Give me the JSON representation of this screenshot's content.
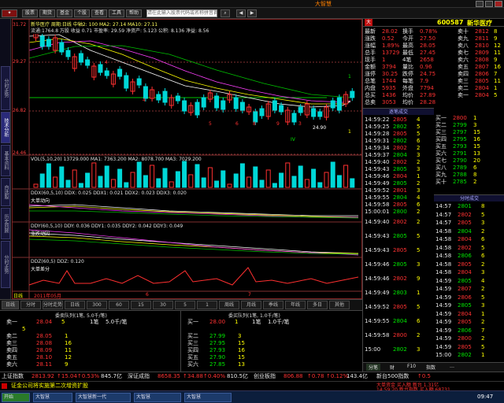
{
  "app": {
    "brand": "大智慧"
  },
  "menu": {
    "labels": [
      "股票",
      "期货",
      "基金",
      "个股",
      "查看",
      "工具",
      "帮助"
    ],
    "search_text": "请在此输入股票代码或名称拼音首字母"
  },
  "header": {
    "code": "600587",
    "name": "新华医疗",
    "badge": "大"
  },
  "chart": {
    "legend_top": "新华医疗  周期:日线   中轴2: 100   MA2: 27.14   MA10: 27.11   ",
    "legend_info": "流通:1764.8 万股  收益 0.71  市盈率: 29.59  净资产: 5.123  公积: 8.136  净益: 8.56",
    "price_labels": [
      "31.72",
      "29.27",
      "26.82",
      "24.46"
    ],
    "low_label": "24.90",
    "vol_legend": "VOL(5,10,20)  13729.000   MA1: 7363.200   MA2: 8078.700   MA3: 7029.200",
    "ind1_legend": "DDX(60,5,10)  DDX: 0.025   DDX1: 0.021   DDX2: 0.023   DDX3: 0.020",
    "ind1_title": "大单动向",
    "ind2_legend": "DDY(60,5,10)  DDY: 0.036   DDY1: 0.035   DDY2: 0.042   DDY3: 0.049",
    "ind2_title": "涨跌动因",
    "ind3_legend": "DDZ(60,5)  DDZ: 0.120",
    "ind3_title": "大单差分",
    "date_labels": [
      "日线",
      "2011年05月",
      "6",
      "7"
    ],
    "annotations": [
      "4",
      "4",
      "5",
      "6",
      "8",
      "9",
      "3",
      "IV",
      "1",
      "1"
    ]
  },
  "left_tabs": [
    "分时走势",
    "技术分析",
    "基本资料",
    "自选股",
    "历史回顾",
    "分时走势"
  ],
  "bottom_tabs": [
    "日线",
    "分时",
    "分时走势",
    "日线",
    "300",
    "60",
    "15",
    "30",
    "5",
    "1",
    "周线",
    "月线",
    "季线",
    "年线",
    "多日",
    "其他"
  ],
  "orderbook": {
    "sell_header": "委卖队列(1笔, 5.0千/笔)",
    "buy_header": "委买队列(1笔, 1.0千/笔)",
    "sell1": {
      "label": "卖一",
      "price": "28.04",
      "vol": "5",
      "sub": "1笔",
      "size": "5.0千/笔"
    },
    "sell_rows": [
      [
        "卖二",
        "28.05",
        "1"
      ],
      [
        "卖三",
        "28.08",
        "16"
      ],
      [
        "卖四",
        "28.09",
        "11"
      ],
      [
        "卖五",
        "28.10",
        "12"
      ],
      [
        "卖六",
        "28.11",
        "9"
      ]
    ],
    "sell_queue": "5",
    "buy1": {
      "label": "买一",
      "price": "28.00",
      "vol": "1",
      "sub": "1笔",
      "size": "1.0千/笔"
    },
    "buy_rows": [
      [
        "买二",
        "27.99",
        "3"
      ],
      [
        "买三",
        "27.95",
        "15"
      ],
      [
        "买四",
        "27.93",
        "16"
      ],
      [
        "买五",
        "27.90",
        "15"
      ],
      [
        "买六",
        "27.85",
        "13"
      ]
    ]
  },
  "quote": {
    "rows": [
      [
        "最新",
        "28.02",
        "换手",
        "0.78%"
      ],
      [
        "涨跌",
        "0.52",
        "今开",
        "27.50"
      ],
      [
        "涨幅",
        "1.89%",
        "最高",
        "28.05"
      ],
      [
        "总手",
        "13729",
        "最低",
        "27.45"
      ],
      [
        "现手",
        "1",
        "4笔",
        "2658"
      ],
      [
        "金额",
        "3794",
        "量比",
        "0.96"
      ],
      [
        "涨停",
        "30.25",
        "跌停",
        "24.75"
      ],
      [
        "总笔",
        "1744",
        "每笔",
        "7.9"
      ],
      [
        "内盘",
        "5935",
        "外盘",
        "7794"
      ],
      [
        "总买",
        "1436",
        "均价",
        "27.89"
      ],
      [
        "总卖",
        "3053",
        "均价",
        "28.28"
      ]
    ],
    "ladder": [
      [
        "卖十",
        "2812",
        "8"
      ],
      [
        "卖九",
        "2811",
        "9"
      ],
      [
        "卖八",
        "2810",
        "12"
      ],
      [
        "卖七",
        "2809",
        "11"
      ],
      [
        "卖六",
        "2808",
        "9"
      ],
      [
        "卖五",
        "2807",
        "16"
      ],
      [
        "卖四",
        "2806",
        "7"
      ],
      [
        "卖三",
        "2805",
        "11"
      ],
      [
        "卖二",
        "2804",
        "1"
      ],
      [
        "卖一",
        "2804",
        "5"
      ]
    ],
    "ladder_right": [
      [
        "买一",
        "2800",
        "1"
      ],
      [
        "买二",
        "2799",
        "3"
      ],
      [
        "买三",
        "2797",
        "15"
      ],
      [
        "买四",
        "2795",
        "16"
      ],
      [
        "买五",
        "2793",
        "15"
      ],
      [
        "买六",
        "2791",
        "13"
      ],
      [
        "买七",
        "2790",
        "20"
      ],
      [
        "买八",
        "2789",
        "6"
      ],
      [
        "买九",
        "2788",
        "8"
      ],
      [
        "买十",
        "2785",
        "2"
      ]
    ],
    "sec_header": "逐笔成交",
    "sec_header2": "分时成交",
    "ticks_left": [
      [
        "14:59:22",
        "2805",
        "4"
      ],
      [
        "14:59:25",
        "2802",
        "5"
      ],
      [
        "14:59:28",
        "2805",
        "5"
      ],
      [
        "14:59:31",
        "2802",
        "6"
      ],
      [
        "14:59:34",
        "2802",
        "2"
      ],
      [
        "14:59:37",
        "2804",
        "3"
      ],
      [
        "14:59:40",
        "2802",
        "2"
      ],
      [
        "14:59:43",
        "2805",
        "3"
      ],
      [
        "14:59:46",
        "2804",
        "1"
      ],
      [
        "14:59:49",
        "2805",
        "2"
      ],
      [
        "14:59:52",
        "2801",
        "3"
      ],
      [
        "14:59:55",
        "2804",
        "4"
      ],
      [
        "14:59:58",
        "2805",
        "6"
      ],
      [
        "15:00:01",
        "2800",
        "2"
      ]
    ],
    "ticks_left2": [
      [
        "14:59:40",
        "2802",
        "2"
      ],
      [
        "14:59:43",
        "2805",
        "5"
      ],
      [
        "14:59:43",
        "2805",
        "5"
      ],
      [
        "14:59:46",
        "2805",
        "3"
      ],
      [
        "14:59:46",
        "2802",
        "9"
      ],
      [
        "14:59:49",
        "2803",
        "1"
      ],
      [
        "14:59:52",
        "2805",
        "5"
      ],
      [
        "14:59:55",
        "2804",
        "6"
      ],
      [
        "14:59:58",
        "2800",
        "2"
      ],
      [
        "15:00",
        "2802",
        "3"
      ]
    ],
    "ticks_right": [
      [
        "14:57",
        "2801",
        "8"
      ],
      [
        "14:57",
        "2802",
        "5"
      ],
      [
        "14:57",
        "2805",
        "3"
      ],
      [
        "14:58",
        "2804",
        "2"
      ],
      [
        "14:58",
        "2804",
        "6"
      ],
      [
        "14:58",
        "2802",
        "5"
      ],
      [
        "14:58",
        "2806",
        "6"
      ],
      [
        "14:58",
        "2805",
        "2"
      ],
      [
        "14:58",
        "2804",
        "3"
      ],
      [
        "14:59",
        "2805",
        "4"
      ],
      [
        "14:59",
        "2807",
        "2"
      ],
      [
        "14:59",
        "2806",
        "5"
      ],
      [
        "14:59",
        "2805",
        "3"
      ],
      [
        "14:59",
        "2804",
        "1"
      ],
      [
        "14:59",
        "2805",
        "2"
      ],
      [
        "14:59",
        "2806",
        "7"
      ],
      [
        "14:59",
        "2800",
        "2"
      ],
      [
        "14:59",
        "2805",
        "5"
      ],
      [
        "15:00",
        "2802",
        "1"
      ]
    ],
    "bottom_tabs": [
      "分笔",
      "财",
      "F10",
      "指数",
      "…"
    ]
  },
  "indexbar": {
    "sh_name": "上证指数",
    "sh_val": "2813.92",
    "sh_chg": "↑15.04",
    "sh_pct": "↑0.53%",
    "sh_amt": "845.7亿",
    "sz_name": "深证成指",
    "sz_val": "8658.35",
    "sz_chg": "↑34.88",
    "sz_pct": "↑0.40%",
    "sz_amt": "810.5亿",
    "cy_name": "创业板指",
    "cy_val": "806.88",
    "cy_chg": "↑0.78",
    "cy_pct": "↑0.12%",
    "cy_amt": "143.4亿",
    "hs_name": "新台500指数",
    "hs_val": "↑0.5"
  },
  "news": {
    "text": "证金公司将实施第二次增资扩股",
    "right_text": "大单资金 买入额  新台 1.31亿",
    "right_text2": "14:59:20 新台指数 买入额  68731"
  },
  "taskbar": {
    "items": [
      "开始",
      "大智慧",
      "大智慧新一代",
      "大智慧",
      "大智慧"
    ],
    "time": "09:47"
  }
}
